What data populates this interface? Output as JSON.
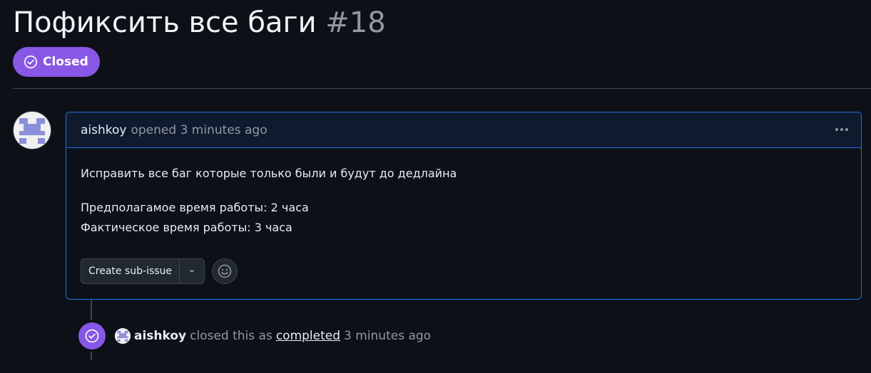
{
  "issue": {
    "title": "Пофиксить все баги",
    "number": "#18",
    "state_label": "Closed",
    "state_color": "#8957e5"
  },
  "comment": {
    "author": "aishkoy",
    "meta": "opened 3 minutes ago",
    "menu_icon": "kebab-horizontal-icon",
    "paragraphs": [
      "Исправить все баг которые только были и будут до дедлайна",
      "Предполагамое время работы: 2 часа",
      "Фактическое время работы: 3 часа"
    ],
    "sub_issue_button": "Create sub-issue",
    "dropdown_icon": "triangle-down-icon",
    "reaction_icon": "smiley-icon"
  },
  "event": {
    "icon": "check-circle-icon",
    "actor": "aishkoy",
    "text_before": "closed this as",
    "link_text": "completed",
    "time": "3 minutes ago"
  },
  "colors": {
    "accent_border": "#1f6feb",
    "background": "#0d1117",
    "muted_text": "#9198a1"
  }
}
